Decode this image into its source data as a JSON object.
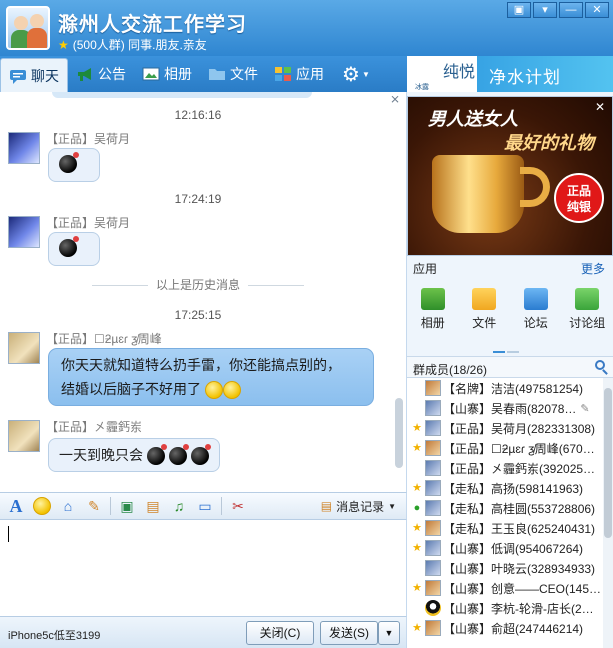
{
  "window": {
    "title": "滁州人交流工作学习",
    "subtitle": "(500人群) 同事.朋友.亲友",
    "buttons": [
      "▣",
      "▾",
      "—",
      "✕"
    ]
  },
  "toolbar": {
    "tabs": [
      {
        "label": "聊天",
        "icon": "chat-icon",
        "active": true
      },
      {
        "label": "公告",
        "icon": "megaphone-icon"
      },
      {
        "label": "相册",
        "icon": "photo-icon"
      },
      {
        "label": "文件",
        "icon": "folder-icon"
      },
      {
        "label": "应用",
        "icon": "apps-icon"
      }
    ],
    "settings_icon": "gear-icon"
  },
  "chat": {
    "messages": [
      {
        "time": "12:16:16",
        "sender": "【正品】吴荷月",
        "content": "bomb"
      },
      {
        "time": "17:24:19",
        "sender": "【正品】吴荷月",
        "content": "bomb"
      },
      {
        "history_divider": "以上是历史消息"
      },
      {
        "time": "17:25:15",
        "sender": "【正品】☐ƻµɛɾ ƺ̸周峰",
        "line1": "你天天就知道特么扔手雷，你还能搞点别的，",
        "line2": "结婚以后脑子不好用了"
      },
      {
        "sender": "【正品】㐅霾鈣岽",
        "text": "一天到晚只会"
      }
    ]
  },
  "input_toolbar": {
    "history_label": "消息记录",
    "icons": [
      "font-icon",
      "emoji-icon",
      "shake-icon",
      "note-icon",
      "image-icon",
      "doc-icon",
      "music-icon",
      "screen-icon",
      "screenshot-icon"
    ]
  },
  "bottom": {
    "ad_text": "iPhone5c低至3199",
    "close_label": "关闭(C)",
    "send_label": "发送(S)"
  },
  "right": {
    "brand_logo": "纯悦",
    "brand_logo_sub": "冰露",
    "brand_text": "净水计划",
    "ad_line1": "男人送女人",
    "ad_line2": "最好的礼物",
    "ad_badge_1": "正品",
    "ad_badge_2": "纯银",
    "apps_label": "应用",
    "apps_more": "更多",
    "apps": [
      {
        "label": "相册",
        "icon": "photo-icon"
      },
      {
        "label": "文件",
        "icon": "file-icon"
      },
      {
        "label": "论坛",
        "icon": "forum-icon"
      },
      {
        "label": "讨论组",
        "icon": "discuss-icon"
      }
    ],
    "members_label": "群成员(18/26)",
    "members": [
      {
        "flag": "",
        "avatar": "role",
        "name": "【名牌】洁洁(497581254)"
      },
      {
        "flag": "",
        "avatar": "photo",
        "name": "【山寨】吴春雨(82078…",
        "edit": true
      },
      {
        "flag": "★",
        "avatar": "photo",
        "name": "【正品】吴荷月(282331308)"
      },
      {
        "flag": "★",
        "avatar": "warm",
        "name": "【正品】☐ƻµɛɾ ƺ̸周峰(670…"
      },
      {
        "flag": "",
        "avatar": "photo",
        "name": "【正品】㐅霾鈣岽(392025…"
      },
      {
        "flag": "★",
        "avatar": "photo",
        "name": "【走私】高扬(598141963)"
      },
      {
        "flag": "●",
        "avatar": "photo",
        "name": "【走私】高桂圆(553728806)"
      },
      {
        "flag": "★",
        "avatar": "warm",
        "name": "【走私】王玉良(625240431)"
      },
      {
        "flag": "★",
        "avatar": "photo",
        "name": "【山寨】低调(954067264)"
      },
      {
        "flag": "",
        "avatar": "photo",
        "name": "【山寨】叶晓云(328934933)"
      },
      {
        "flag": "★",
        "avatar": "warm",
        "name": "【山寨】创意——CEO(145…"
      },
      {
        "flag": "",
        "avatar": "qq",
        "name": "【山寨】李杭-轮滑-店长(2…"
      },
      {
        "flag": "★",
        "avatar": "warm",
        "name": "【山寨】俞超(247446214)"
      }
    ]
  }
}
